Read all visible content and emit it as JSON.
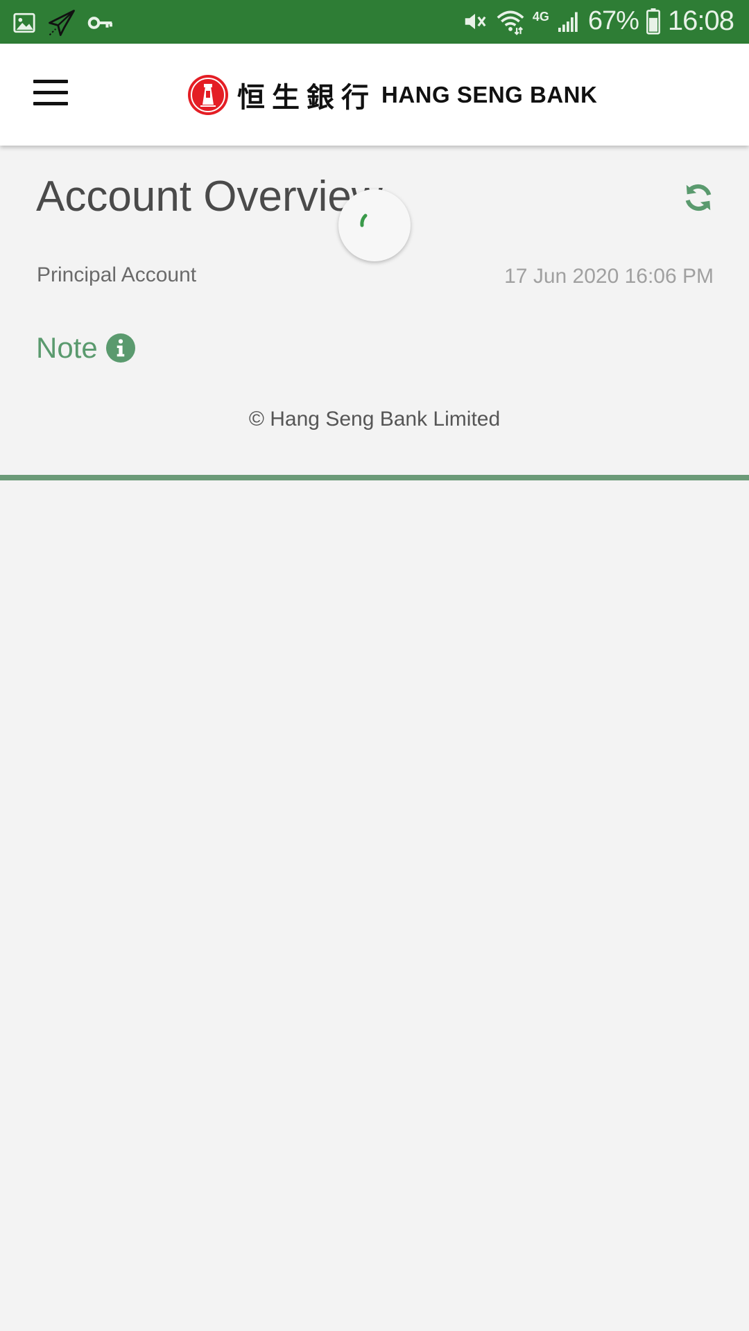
{
  "status_bar": {
    "battery_percent": "67%",
    "clock": "16:08",
    "network_type": "4G",
    "left_icons": [
      "image-icon",
      "paper-plane-icon",
      "key-icon"
    ],
    "right_icons": [
      "mute-icon",
      "wifi-icon",
      "signal-icon",
      "battery-icon"
    ],
    "color": "#2e7d35"
  },
  "header": {
    "logo_cn": "恒生銀行",
    "logo_en": "HANG SENG BANK",
    "brand_color": "#e41e25"
  },
  "main": {
    "title": "Account Overview",
    "account_label": "Principal Account",
    "timestamp": "17 Jun 2020 16:06 PM",
    "note_label": "Note",
    "copyright": "© Hang Seng Bank Limited",
    "accent_color": "#5a9a6e"
  },
  "loading": {
    "visible": true,
    "spinner_color": "#3a9a4a"
  }
}
